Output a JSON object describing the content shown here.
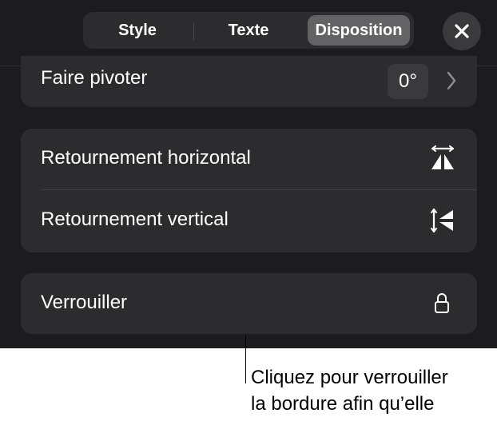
{
  "tabs": [
    {
      "label": "Style"
    },
    {
      "label": "Texte"
    },
    {
      "label": "Disposition",
      "selected": true
    }
  ],
  "close_icon": "close-icon",
  "rotate": {
    "label": "Faire pivoter",
    "value": "0°",
    "icon": "chevron-right-icon"
  },
  "flip": {
    "horizontal_label": "Retournement horizontal",
    "horizontal_icon": "flip-horizontal-icon",
    "vertical_label": "Retournement vertical",
    "vertical_icon": "flip-vertical-icon"
  },
  "lock": {
    "label": "Verrouiller",
    "icon": "lock-icon"
  },
  "callout": {
    "text": "Cliquez pour verrouiller\nla bordure afin qu’elle"
  },
  "colors": {
    "panel_bg": "#1c1c1e",
    "group_bg": "#2c2c2e",
    "selected_tab": "#636366",
    "text": "#ffffff"
  }
}
